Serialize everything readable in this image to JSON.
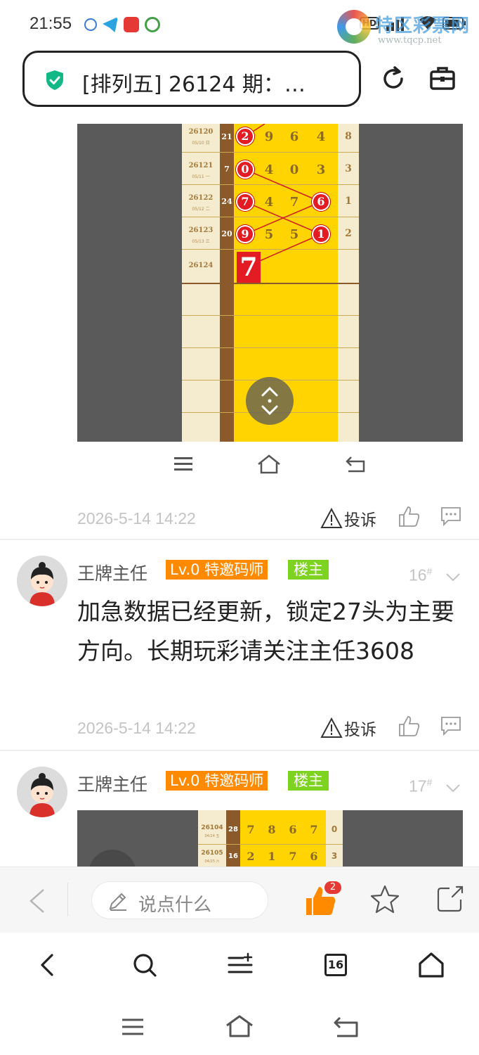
{
  "status_bar": {
    "time": "21:55",
    "right_text": "HD",
    "watermark_text": "特区彩票网",
    "watermark_url": "www.tqcp.net"
  },
  "address_bar": {
    "title": "[排列五] 26124 期：…",
    "secure_icon": "shield-check-icon",
    "accent_color": "#12b886"
  },
  "chart_image": {
    "rows": [
      {
        "issue": "26120",
        "date": "05/10 日",
        "span": "21",
        "digits": [
          "2",
          "9",
          "6",
          "4"
        ],
        "ball_index": 0,
        "right": "8"
      },
      {
        "issue": "26121",
        "date": "05/11 一",
        "span": "7",
        "digits": [
          "0",
          "4",
          "0",
          "3"
        ],
        "ball_index": 0,
        "right": "3"
      },
      {
        "issue": "26122",
        "date": "05/12 二",
        "span": "24",
        "digits": [
          "7",
          "4",
          "7",
          "6"
        ],
        "ball_indexes": [
          0,
          3
        ],
        "right": "1"
      },
      {
        "issue": "26123",
        "date": "05/13 三",
        "span": "20",
        "digits": [
          "9",
          "5",
          "5",
          "1"
        ],
        "ball_indexes": [
          0,
          3
        ],
        "right": "2"
      },
      {
        "issue": "26124",
        "date": "",
        "span": "",
        "digits": [
          "7"
        ],
        "right": ""
      }
    ]
  },
  "posts": [
    {
      "time": "2026-5-14 14:22",
      "complain_label": "投诉"
    },
    {
      "author": "王牌主任",
      "level_badge": "Lv.0 特邀码师",
      "owner_badge": "楼主",
      "floor": "16",
      "floor_mark": "#",
      "text": "加急数据已经更新，锁定27头为主要方向。长期玩彩请关注主任3608",
      "time": "2026-5-14 14:22",
      "complain_label": "投诉"
    },
    {
      "author": "王牌主任",
      "level_badge": "Lv.0 特邀码师",
      "owner_badge": "楼主",
      "floor": "17",
      "floor_mark": "#",
      "preview_rows": [
        {
          "issue": "26104",
          "date": "04/24 五",
          "span": "28",
          "digits": [
            "7",
            "8",
            "6",
            "7"
          ],
          "right": "0"
        },
        {
          "issue": "26105",
          "date": "04/25 六",
          "span": "16",
          "digits": [
            "2",
            "1",
            "7",
            "6"
          ],
          "right": "3"
        }
      ]
    }
  ],
  "reply_bar": {
    "placeholder": "说点什么",
    "like_count": "2"
  },
  "browser_nav": {
    "tab_count": "16"
  },
  "colors": {
    "level_badge": "#ff8a00",
    "owner_badge": "#7ed321",
    "like_active": "#ff8a00",
    "ball_red": "#e31b23",
    "chart_yellow": "#ffd400"
  }
}
